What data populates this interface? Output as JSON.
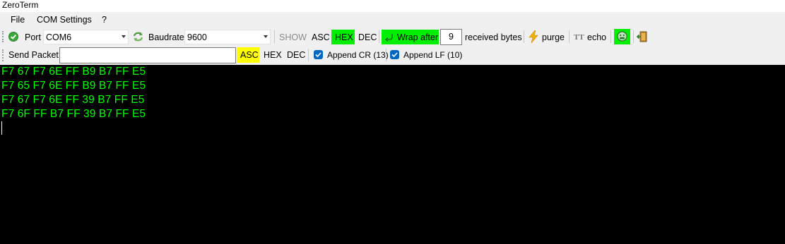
{
  "window": {
    "title": "ZeroTerm"
  },
  "menu": {
    "file": "File",
    "com_settings": "COM Settings",
    "help": "?"
  },
  "toolbar1": {
    "port_label": "Port",
    "port_value": "COM6",
    "baudrate_label": "Baudrate",
    "baudrate_value": "9600",
    "show_label": "SHOW",
    "asc_label": "ASC",
    "hex_label": "HEX",
    "dec_label": "DEC",
    "wrap_label": "Wrap after",
    "wrap_value": "9",
    "received_bytes_label": "received bytes",
    "purge_label": "purge",
    "echo_label": "echo",
    "echo_icon_text": "TT",
    "active_mode": "HEX",
    "active_color": "#00ee00"
  },
  "toolbar2": {
    "send_label": "Send Packet:",
    "send_value": "",
    "asc_label": "ASC",
    "hex_label": "HEX",
    "dec_label": "DEC",
    "append_cr_label": "Append CR (13)",
    "append_cr_checked": true,
    "append_lf_label": "Append LF (10)",
    "append_lf_checked": true,
    "active_mode": "ASC",
    "active_color": "#ffff00"
  },
  "terminal": {
    "text_color": "#00ff00",
    "background": "#000000",
    "lines": [
      "F7 67 F7 6E FF B9 B7 FF E5",
      "F7 65 F7 6E FF B9 B7 FF E5",
      "F7 67 F7 6E FF 39 B7 FF E5",
      "F7 6F FF B7 FF 39 B7 FF E5"
    ]
  },
  "icons": {
    "connect": "check-circle-icon",
    "baud_refresh": "refresh-icon",
    "purge": "lightning-icon",
    "echo": "tt-icon",
    "logger": "face-icon",
    "exit": "exit-door-icon"
  }
}
